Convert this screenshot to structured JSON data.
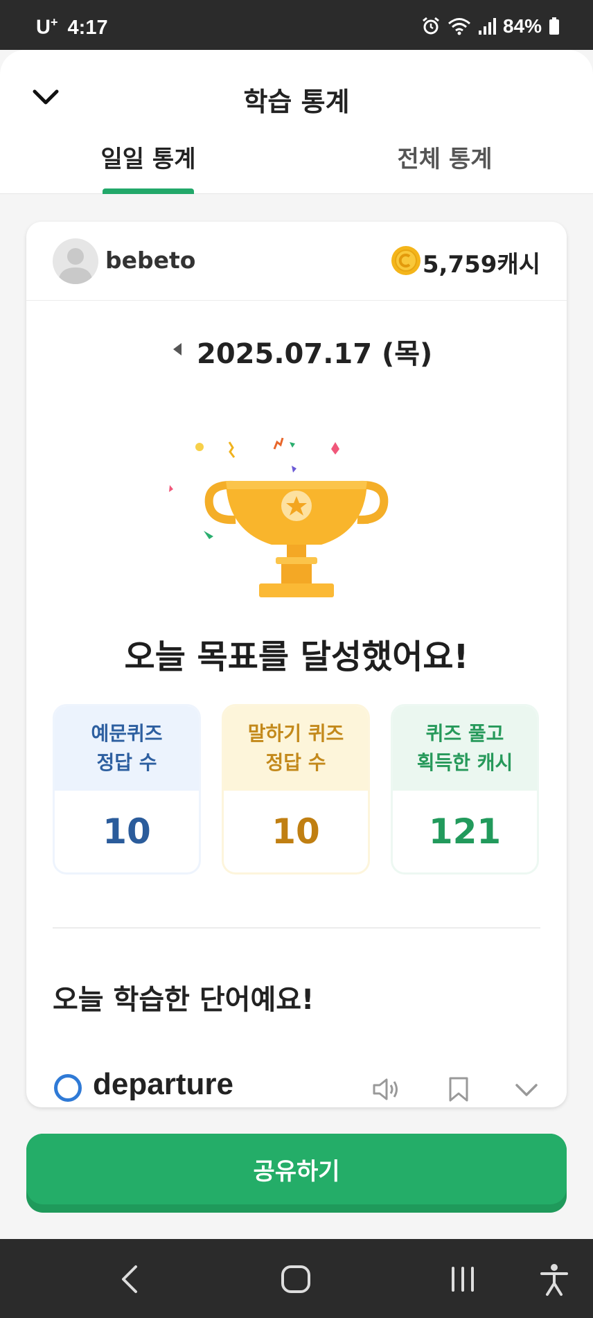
{
  "status_bar": {
    "carrier": "U",
    "carrier_mark": "+",
    "time": "4:17",
    "battery": "84%",
    "icons": [
      "alarm-icon",
      "wifi-icon",
      "signal-icon",
      "battery-icon"
    ]
  },
  "header": {
    "title": "학습 통계",
    "close_icon": "chevron-down-icon"
  },
  "tabs": [
    {
      "label": "일일 통계",
      "active": true
    },
    {
      "label": "전체 통계",
      "active": false
    }
  ],
  "profile": {
    "username": "bebeto",
    "cash": "5,759캐시",
    "coin_icon": "coin-icon"
  },
  "date": {
    "text": "2025.07.17 (목)",
    "prev_icon": "caret-left-icon"
  },
  "goal": {
    "title": "오늘 목표를 달성했어요!",
    "image": "trophy-icon"
  },
  "stats": [
    {
      "label": "예문퀴즈\n정답 수",
      "value": "10",
      "color": "#2b5c9b"
    },
    {
      "label": "말하기 퀴즈\n정답 수",
      "value": "10",
      "color": "#c07f12"
    },
    {
      "label": "퀴즈 풀고\n획득한 캐시",
      "value": "121",
      "color": "#229a5c"
    }
  ],
  "words_section": {
    "title": "오늘 학습한 단어예요!",
    "items": [
      {
        "word": "departure",
        "mark": "circle-o-icon"
      }
    ]
  },
  "share_button": {
    "label": "공유하기",
    "color": "#24ad68"
  },
  "nav_bar": {
    "icons": [
      "back-icon",
      "home-icon",
      "recents-icon",
      "accessibility-icon"
    ]
  },
  "colors": {
    "accent": "#22a86a"
  }
}
